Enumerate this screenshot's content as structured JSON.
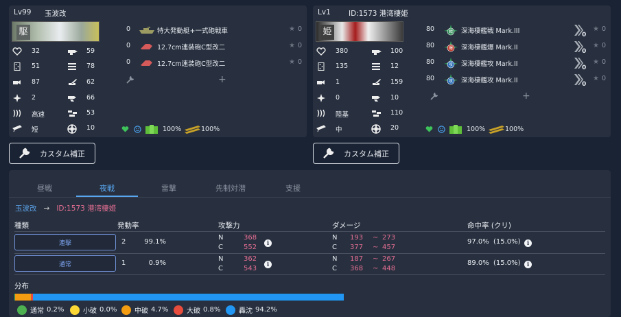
{
  "left_ship": {
    "level": "Lv99",
    "name": "玉波改",
    "stats": [
      {
        "icon": "heart-icon",
        "value": "32"
      },
      {
        "icon": "armor-icon",
        "value": "51"
      },
      {
        "icon": "evasion-icon",
        "value": "87"
      },
      {
        "icon": "aircraft-icon",
        "value": "2"
      },
      {
        "icon": "speed-icon",
        "value": "高速"
      },
      {
        "icon": "range-icon",
        "value": "短"
      }
    ],
    "stats2": [
      {
        "icon": "firepower-icon",
        "value": "59"
      },
      {
        "icon": "torpedo-icon",
        "value": "78"
      },
      {
        "icon": "antiair-icon",
        "value": "62"
      },
      {
        "icon": "asw-icon",
        "value": "66"
      },
      {
        "icon": "los-icon",
        "value": "53"
      },
      {
        "icon": "luck-icon",
        "value": "10"
      }
    ],
    "equipment": [
      {
        "slot": "0",
        "name": "特大発動艇+一式砲戦車",
        "stars": "0"
      },
      {
        "slot": "0",
        "name": "12.7cm連装砲C型改二",
        "stars": "0"
      },
      {
        "slot": "0",
        "name": "12.7cm連装砲C型改二",
        "stars": "0"
      }
    ],
    "morale": "100%",
    "ammo": "100%"
  },
  "right_ship": {
    "level": "Lv1",
    "name": "ID:1573 港湾棲姫",
    "stats": [
      {
        "icon": "heart-icon",
        "value": "380"
      },
      {
        "icon": "armor-icon",
        "value": "135"
      },
      {
        "icon": "evasion-icon",
        "value": "1"
      },
      {
        "icon": "aircraft-icon",
        "value": "0"
      },
      {
        "icon": "speed-icon",
        "value": "陸基"
      },
      {
        "icon": "range-icon",
        "value": "中"
      }
    ],
    "stats2": [
      {
        "icon": "firepower-icon",
        "value": "100"
      },
      {
        "icon": "torpedo-icon",
        "value": "12"
      },
      {
        "icon": "antiair-icon",
        "value": "159"
      },
      {
        "icon": "asw-icon",
        "value": "10"
      },
      {
        "icon": "los-icon",
        "value": "110"
      },
      {
        "icon": "luck-icon",
        "value": "20"
      }
    ],
    "equipment": [
      {
        "slot": "80",
        "name": "深海棲艦戦 Mark.III",
        "badge": "戦",
        "badge_color": "#2e8b57",
        "stars": "0",
        "prof": "0"
      },
      {
        "slot": "80",
        "name": "深海棲艦爆 Mark.II",
        "badge": "爆",
        "badge_color": "#c0392b",
        "stars": "0",
        "prof": "0"
      },
      {
        "slot": "80",
        "name": "深海棲艦攻 Mark.II",
        "badge": "攻",
        "badge_color": "#2c6fb7",
        "stars": "0",
        "prof": "0"
      },
      {
        "slot": "80",
        "name": "深海棲艦攻 Mark.II",
        "badge": "攻",
        "badge_color": "#2c6fb7",
        "stars": "0",
        "prof": "0"
      }
    ],
    "morale": "100%",
    "ammo": "100%"
  },
  "custom_button": "カスタム補正",
  "tabs": [
    "昼戦",
    "夜戦",
    "雷撃",
    "先制対潜",
    "支援"
  ],
  "active_tab": 1,
  "breadcrumb": {
    "from": "玉波改",
    "to": "ID:1573 港湾棲姫"
  },
  "columns": {
    "type": "種類",
    "rate": "発動率",
    "power": "攻撃力",
    "damage": "ダメージ",
    "hit": "命中率 (クリ)"
  },
  "attacks": [
    {
      "type": "連撃",
      "count": "2",
      "rate": "99.1%",
      "N": "N",
      "C": "C",
      "powN": "368",
      "powC": "552",
      "dmgN_lo": "193",
      "dmgN_hi": "273",
      "dmgC_lo": "377",
      "dmgC_hi": "457",
      "tilde": "~",
      "hit": "97.0%",
      "crit": "(15.0%)"
    },
    {
      "type": "通常",
      "count": "1",
      "rate": "0.9%",
      "N": "N",
      "C": "C",
      "powN": "362",
      "powC": "543",
      "dmgN_lo": "187",
      "dmgN_hi": "267",
      "dmgC_lo": "368",
      "dmgC_hi": "448",
      "tilde": "~",
      "hit": "89.0%",
      "crit": "(15.0%)"
    }
  ],
  "distribution": {
    "label": "分布",
    "bar": [
      {
        "name": "通常",
        "percent": 0.2,
        "color": "#4caf50"
      },
      {
        "name": "小破",
        "percent": 0.0,
        "color": "#fdd835"
      },
      {
        "name": "中破",
        "percent": 4.7,
        "color": "#f39c12"
      },
      {
        "name": "大破",
        "percent": 0.8,
        "color": "#e74c3c"
      },
      {
        "name": "轟沈",
        "percent": 94.2,
        "color": "#2196f3"
      }
    ],
    "legend": [
      {
        "name": "通常",
        "value": "0.2%",
        "color": "#4caf50"
      },
      {
        "name": "小破",
        "value": "0.0%",
        "color": "#fdd835"
      },
      {
        "name": "中破",
        "value": "4.7%",
        "color": "#f39c12"
      },
      {
        "name": "大破",
        "value": "0.8%",
        "color": "#e74c3c"
      },
      {
        "name": "轟沈",
        "value": "94.2%",
        "color": "#2196f3"
      }
    ]
  }
}
